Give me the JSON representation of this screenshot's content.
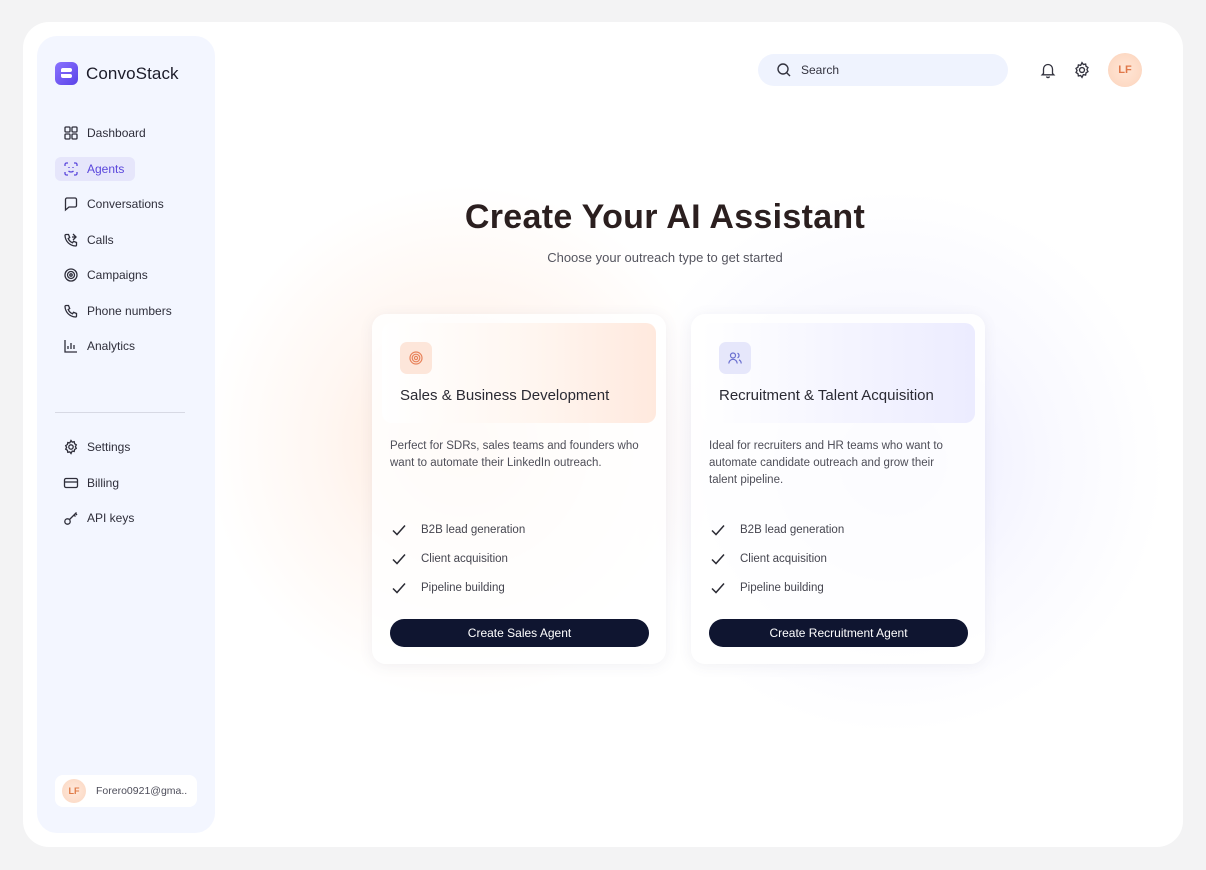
{
  "brand": {
    "name": "ConvoStack"
  },
  "sidebar": {
    "items": [
      {
        "label": "Dashboard",
        "icon": "grid-icon"
      },
      {
        "label": "Agents",
        "icon": "scan-face-icon",
        "active": true
      },
      {
        "label": "Conversations",
        "icon": "message-icon"
      },
      {
        "label": "Calls",
        "icon": "phone-forward-icon"
      },
      {
        "label": "Campaigns",
        "icon": "target-icon"
      },
      {
        "label": "Phone numbers",
        "icon": "phone-icon"
      },
      {
        "label": "Analytics",
        "icon": "bar-chart-icon"
      }
    ],
    "secondary_items": [
      {
        "label": "Settings",
        "icon": "gear-icon"
      },
      {
        "label": "Billing",
        "icon": "credit-card-icon"
      },
      {
        "label": "API keys",
        "icon": "key-icon"
      }
    ],
    "user": {
      "initials": "LF",
      "email": "Forero0921@gma..."
    }
  },
  "header": {
    "search": {
      "placeholder": "Search"
    },
    "avatar_initials": "LF"
  },
  "hero": {
    "title": "Create Your AI Assistant",
    "subtitle": "Choose your outreach type to get started"
  },
  "cards": [
    {
      "title": "Sales & Business Development",
      "icon": "target-icon",
      "description": "Perfect for SDRs, sales teams and founders who want to automate their LinkedIn outreach.",
      "features": [
        "B2B lead generation",
        "Client acquisition",
        "Pipeline building"
      ],
      "cta": "Create Sales Agent"
    },
    {
      "title": "Recruitment & Talent Acquisition",
      "icon": "users-icon",
      "description": "Ideal for recruiters and HR teams who want to automate candidate outreach and grow their talent pipeline.",
      "features": [
        "B2B lead generation",
        "Client acquisition",
        "Pipeline building"
      ],
      "cta": "Create Recruitment Agent"
    }
  ],
  "colors": {
    "accent": "#5a46dc",
    "cta_background": "#0f1530",
    "sidebar_background": "#f3f6ff",
    "sales_accent": "#e8825a",
    "recruit_accent": "#6a6fd0"
  }
}
